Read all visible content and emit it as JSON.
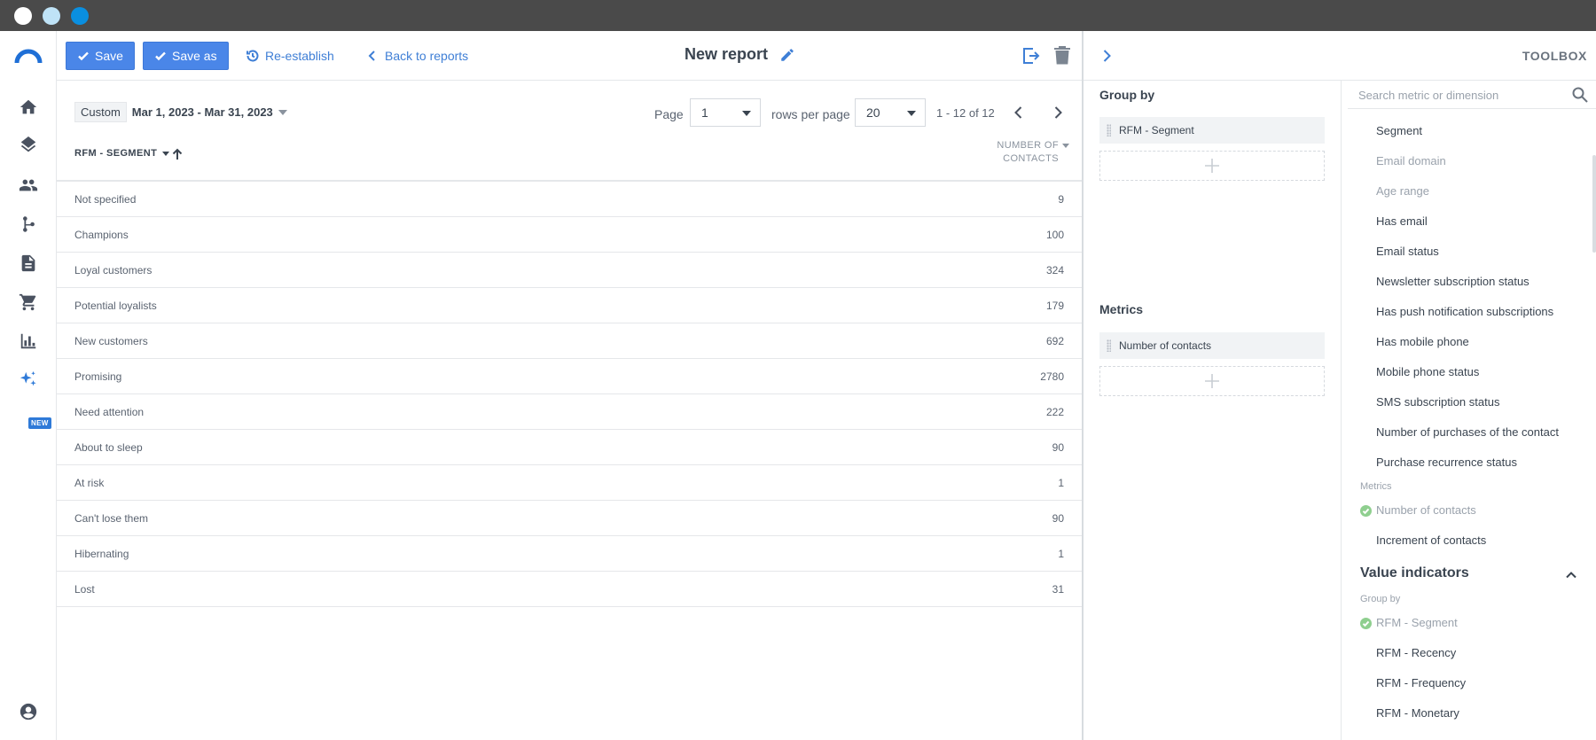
{
  "toolbar": {
    "save_label": "Save",
    "save_as_label": "Save as",
    "reestablish_label": "Re-establish",
    "back_label": "Back to reports",
    "title": "New report"
  },
  "filters": {
    "date_mode": "Custom",
    "date_range": "Mar 1, 2023 - Mar 31, 2023"
  },
  "pager": {
    "page_label": "Page",
    "page_value": "1",
    "rows_label": "rows per page",
    "rows_value": "20",
    "count": "1 - 12 of 12"
  },
  "table": {
    "dimension_header": "RFM - SEGMENT",
    "metric_header_line1": "NUMBER OF",
    "metric_header_line2": "CONTACTS",
    "rows": [
      {
        "label": "Not specified",
        "value": "9"
      },
      {
        "label": "Champions",
        "value": "100"
      },
      {
        "label": "Loyal customers",
        "value": "324"
      },
      {
        "label": "Potential loyalists",
        "value": "179"
      },
      {
        "label": "New customers",
        "value": "692"
      },
      {
        "label": "Promising",
        "value": "2780"
      },
      {
        "label": "Need attention",
        "value": "222"
      },
      {
        "label": "About to sleep",
        "value": "90"
      },
      {
        "label": "At risk",
        "value": "1"
      },
      {
        "label": "Can't lose them",
        "value": "90"
      },
      {
        "label": "Hibernating",
        "value": "1"
      },
      {
        "label": "Lost",
        "value": "31"
      }
    ]
  },
  "nav": {
    "new_badge": "NEW"
  },
  "toolbox": {
    "title": "TOOLBOX",
    "group_by_title": "Group by",
    "group_by_chip": "RFM - Segment",
    "metrics_title": "Metrics",
    "metrics_chip": "Number of contacts",
    "search_placeholder": "Search metric or dimension",
    "fields": {
      "segment": "Segment",
      "email_domain": "Email domain",
      "age_range": "Age range",
      "has_email": "Has email",
      "email_status": "Email status",
      "newsletter_status": "Newsletter subscription status",
      "has_push": "Has push notification subscriptions",
      "has_mobile": "Has mobile phone",
      "mobile_status": "Mobile phone status",
      "sms_status": "SMS subscription status",
      "num_purchases": "Number of purchases of the contact",
      "purchase_recurrence": "Purchase recurrence status",
      "metrics_label": "Metrics",
      "num_contacts": "Number of contacts",
      "increment_contacts": "Increment of contacts",
      "value_indicators_title": "Value indicators",
      "group_by_label": "Group by",
      "rfm_segment": "RFM - Segment",
      "rfm_recency": "RFM - Recency",
      "rfm_frequency": "RFM - Frequency",
      "rfm_monetary": "RFM - Monetary"
    }
  },
  "colors": {
    "accent": "#4a86e8",
    "link": "#3f7fd6",
    "check": "#8fcf8f"
  }
}
